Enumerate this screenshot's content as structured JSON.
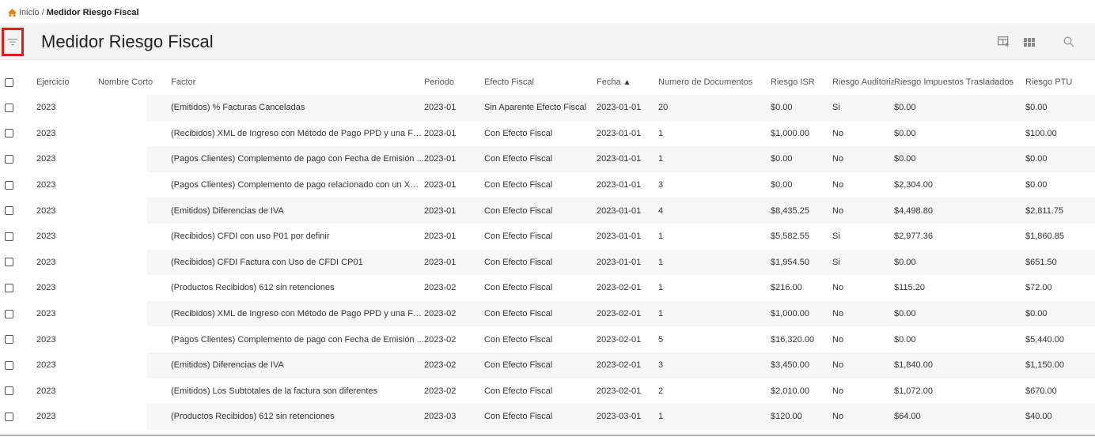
{
  "breadcrumb": {
    "home": "Inicio",
    "separator": "/",
    "current": "Medidor Riesgo Fiscal"
  },
  "header": {
    "title": "Medidor Riesgo Fiscal"
  },
  "icons": {
    "filter": "filter-icon",
    "columns": "table-columns-icon",
    "grid": "grid-view-icon",
    "search": "search-icon"
  },
  "colors": {
    "accent": "#e8840c",
    "highlight_border": "#e01b1b",
    "header_bg": "#f4f4f4"
  },
  "table": {
    "sort_indicator": "▲",
    "columns": [
      "Ejercicio",
      "Nombre Corto",
      "Factor",
      "Periodo",
      "Efecto Fiscal",
      "Fecha",
      "Numero de Documentos",
      "Riesgo ISR",
      "Riesgo Auditoria",
      "Riesgo Impuestos Trasladados",
      "Riesgo PTU"
    ],
    "rows": [
      [
        "2023",
        "",
        "(Emitidos) % Facturas Canceladas",
        "2023-01",
        "Sin Aparente Efecto Fiscal",
        "2023-01-01",
        "20",
        "$0.00",
        "Si",
        "$0.00",
        "$0.00"
      ],
      [
        "2023",
        "",
        "(Recibidos) XML de Ingreso con Método de Pago PPD y una Fo...",
        "2023-01",
        "Con Efecto Fiscal",
        "2023-01-01",
        "1",
        "$1,000.00",
        "No",
        "$0.00",
        "$100.00"
      ],
      [
        "2023",
        "",
        "(Pagos Clientes) Complemento de pago con Fecha de Emisión ...",
        "2023-01",
        "Con Efecto Fiscal",
        "2023-01-01",
        "1",
        "$0.00",
        "No",
        "$0.00",
        "$0.00"
      ],
      [
        "2023",
        "",
        "(Pagos Clientes) Complemento de pago relacionado con un XM...",
        "2023-01",
        "Con Efecto Fiscal",
        "2023-01-01",
        "3",
        "$0.00",
        "No",
        "$2,304.00",
        "$0.00"
      ],
      [
        "2023",
        "",
        "(Emitidos) Diferencias de IVA",
        "2023-01",
        "Con Efecto Fiscal",
        "2023-01-01",
        "4",
        "$8,435.25",
        "No",
        "$4,498.80",
        "$2,811.75"
      ],
      [
        "2023",
        "",
        "(Recibidos) CFDI con uso P01 por definir",
        "2023-01",
        "Con Efecto Fiscal",
        "2023-01-01",
        "1",
        "$5,582.55",
        "Si",
        "$2,977.36",
        "$1,860.85"
      ],
      [
        "2023",
        "",
        "(Recibidos) CFDI Factura con Uso de CFDI CP01",
        "2023-01",
        "Con Efecto Fiscal",
        "2023-01-01",
        "1",
        "$1,954.50",
        "Si",
        "$0.00",
        "$651.50"
      ],
      [
        "2023",
        "",
        "(Productos Recibidos) 612 sin retenciones",
        "2023-02",
        "Con Efecto Fiscal",
        "2023-02-01",
        "1",
        "$216.00",
        "No",
        "$115.20",
        "$72.00"
      ],
      [
        "2023",
        "",
        "(Recibidos) XML de Ingreso con Método de Pago PPD y una Fo...",
        "2023-02",
        "Con Efecto Fiscal",
        "2023-02-01",
        "1",
        "$1,000.00",
        "No",
        "$0.00",
        "$0.00"
      ],
      [
        "2023",
        "",
        "(Pagos Clientes) Complemento de pago con Fecha de Emisión ...",
        "2023-02",
        "Con Efecto Fiscal",
        "2023-02-01",
        "5",
        "$16,320.00",
        "No",
        "$0.00",
        "$5,440.00"
      ],
      [
        "2023",
        "",
        "(Emitidos) Diferencias de IVA",
        "2023-02",
        "Con Efecto Fiscal",
        "2023-02-01",
        "3",
        "$3,450.00",
        "No",
        "$1,840.00",
        "$1,150.00"
      ],
      [
        "2023",
        "",
        "(Emitidos) Los Subtotales de la factura son diferentes",
        "2023-02",
        "Con Efecto Fiscal",
        "2023-02-01",
        "2",
        "$2,010.00",
        "No",
        "$1,072.00",
        "$670.00"
      ],
      [
        "2023",
        "",
        "(Productos Recibidos) 612 sin retenciones",
        "2023-03",
        "Con Efecto Fiscal",
        "2023-03-01",
        "1",
        "$120.00",
        "No",
        "$64.00",
        "$40.00"
      ]
    ]
  }
}
